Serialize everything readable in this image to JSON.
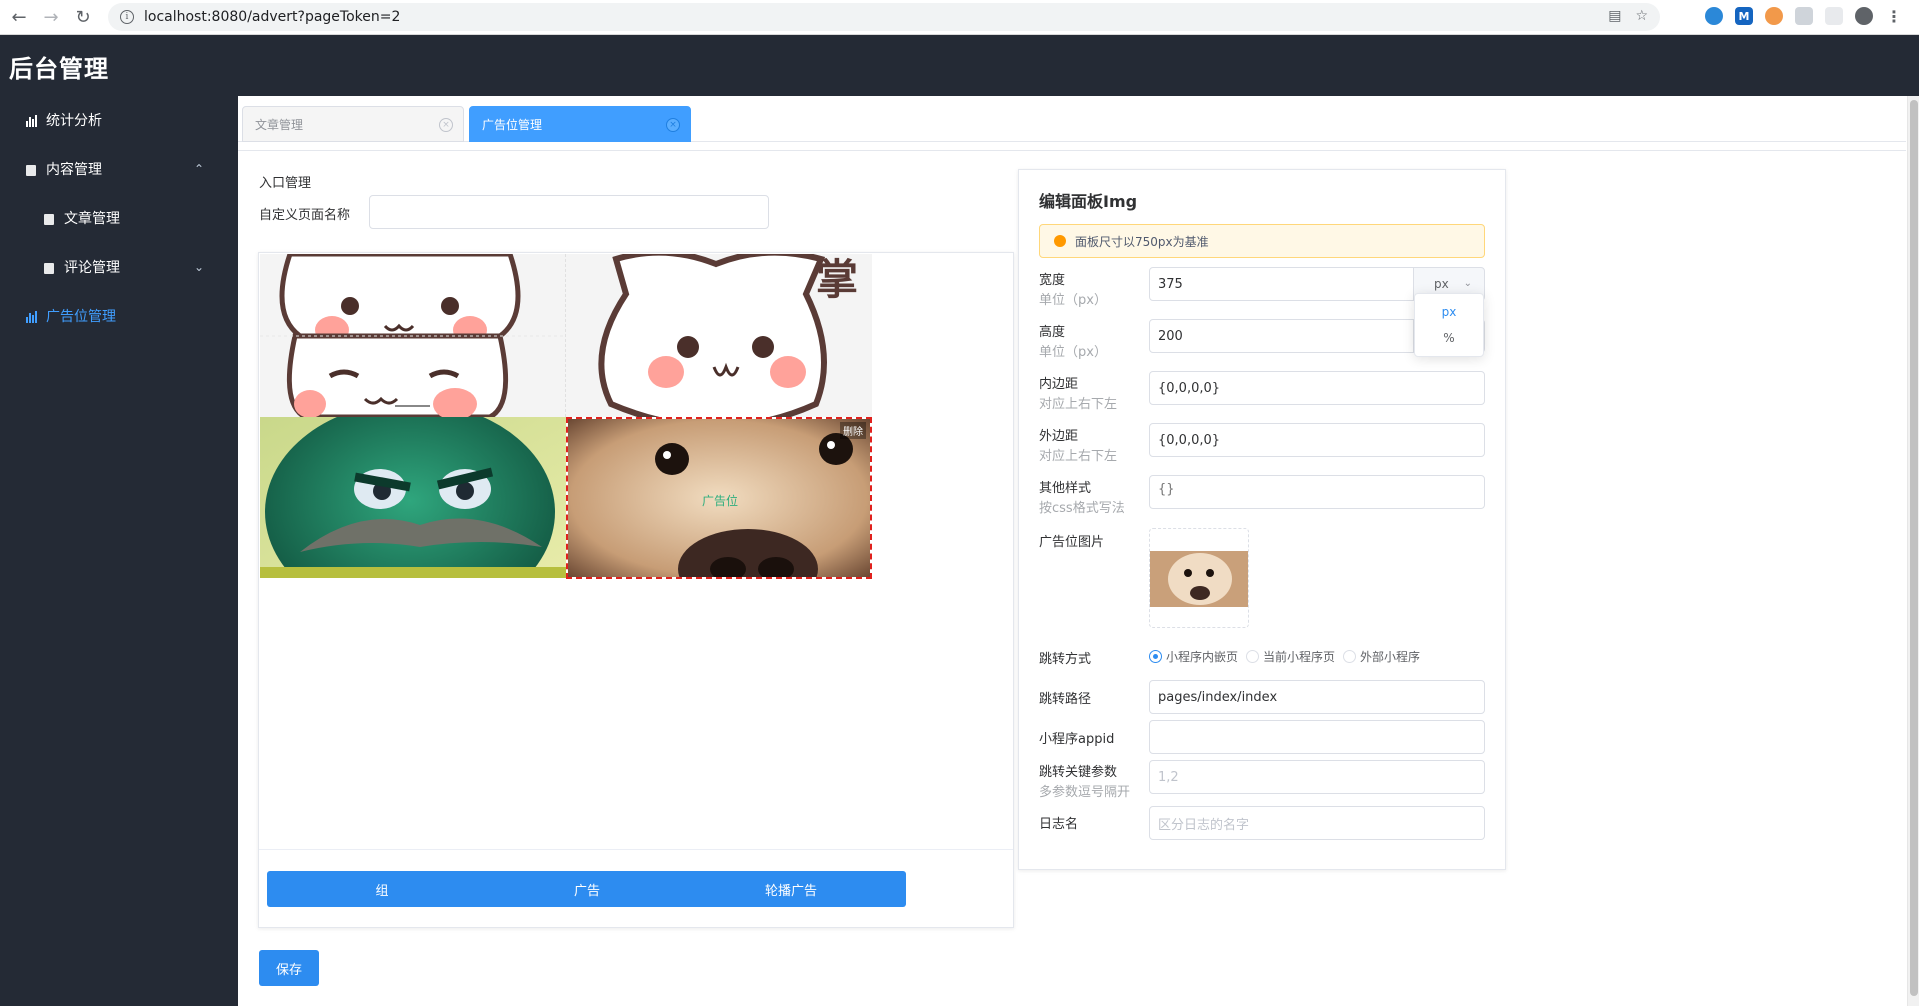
{
  "browser": {
    "url": "localhost:8080/advert?pageToken=2"
  },
  "app": {
    "brand": "后台管理"
  },
  "sidebar": {
    "items": [
      {
        "label": "统计分析"
      },
      {
        "label": "内容管理"
      },
      {
        "label": "文章管理"
      },
      {
        "label": "评论管理"
      },
      {
        "label": "广告位管理"
      }
    ]
  },
  "tabs": [
    {
      "label": "文章管理",
      "close": "×"
    },
    {
      "label": "广告位管理",
      "close": "×"
    }
  ],
  "editor": {
    "section_title": "入口管理",
    "name_label": "自定义页面名称",
    "name_value": "",
    "delete_label": "删除",
    "ad_label": "广告位",
    "buttons": {
      "group": "组",
      "ad": "广告",
      "carousel": "轮播广告"
    },
    "save": "保存"
  },
  "panel": {
    "title": "编辑面板Img",
    "alert": "面板尺寸以750px为基准",
    "width": {
      "label": "宽度",
      "sub": "单位（px）",
      "value": "375",
      "unit": "px"
    },
    "height": {
      "label": "高度",
      "sub": "单位（px）",
      "value": "200",
      "unit": "px"
    },
    "unit_options": [
      "px",
      "%"
    ],
    "padding": {
      "label": "内边距",
      "sub": "对应上右下左",
      "value": "{0,0,0,0}"
    },
    "margin": {
      "label": "外边距",
      "sub": "对应上右下左",
      "value": "{0,0,0,0}"
    },
    "other_style": {
      "label": "其他样式",
      "sub": "按css格式写法",
      "placeholder": "{}"
    },
    "image": {
      "label": "广告位图片"
    },
    "jump_type": {
      "label": "跳转方式",
      "options": [
        "小程序内嵌页",
        "当前小程序页",
        "外部小程序"
      ],
      "selected": "小程序内嵌页"
    },
    "jump_path": {
      "label": "跳转路径",
      "value": "pages/index/index"
    },
    "appid": {
      "label": "小程序appid",
      "value": ""
    },
    "key_params": {
      "label": "跳转关键参数",
      "sub": "多参数逗号隔开",
      "placeholder": "1,2"
    },
    "log_name": {
      "label": "日志名",
      "placeholder": "区分日志的名字"
    }
  }
}
